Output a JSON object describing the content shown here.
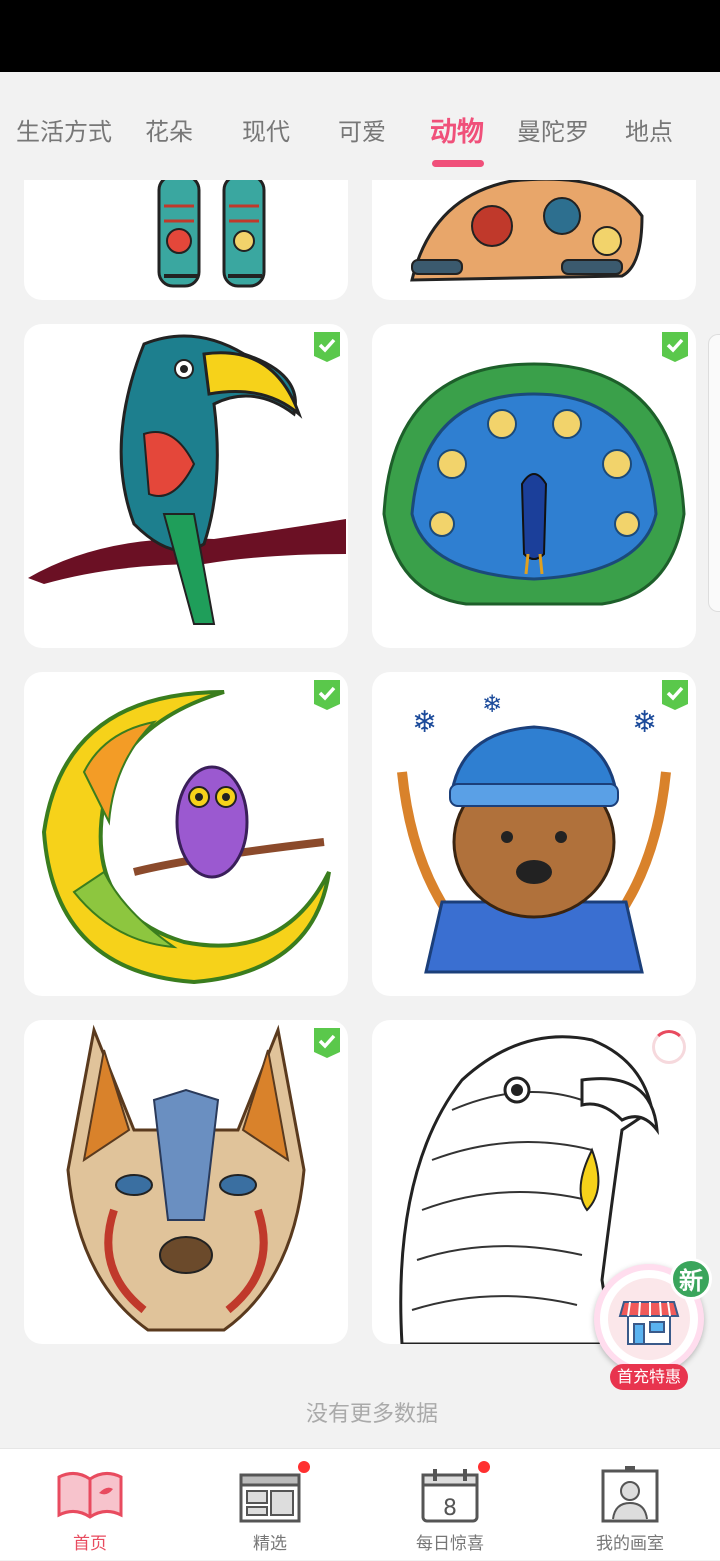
{
  "tabs": {
    "items": [
      {
        "label": "生活方式"
      },
      {
        "label": "花朵"
      },
      {
        "label": "现代"
      },
      {
        "label": "可爱"
      },
      {
        "label": "动物",
        "active": true
      },
      {
        "label": "曼陀罗"
      },
      {
        "label": "地点"
      }
    ],
    "accent": "#f0507a"
  },
  "gallery": {
    "cards": [
      {
        "subject": "elephant-legs",
        "completed": false
      },
      {
        "subject": "bear-mandala",
        "completed": false
      },
      {
        "subject": "toucan",
        "completed": true
      },
      {
        "subject": "peacock",
        "completed": true
      },
      {
        "subject": "owl-on-moon",
        "completed": true
      },
      {
        "subject": "bear-in-hat",
        "completed": true
      },
      {
        "subject": "dog-head",
        "completed": true
      },
      {
        "subject": "eagle-head",
        "completed": false,
        "loading": true
      }
    ],
    "end_text": "没有更多数据"
  },
  "promo": {
    "badge": "新",
    "label": "首充特惠"
  },
  "bottom_nav": {
    "items": [
      {
        "label": "首页",
        "icon": "book-icon",
        "active": true
      },
      {
        "label": "精选",
        "icon": "layout-icon",
        "dot": true
      },
      {
        "label": "每日惊喜",
        "icon": "calendar-icon",
        "dot": true
      },
      {
        "label": "我的画室",
        "icon": "profile-frame-icon"
      }
    ],
    "active_color": "#e84b5f"
  }
}
